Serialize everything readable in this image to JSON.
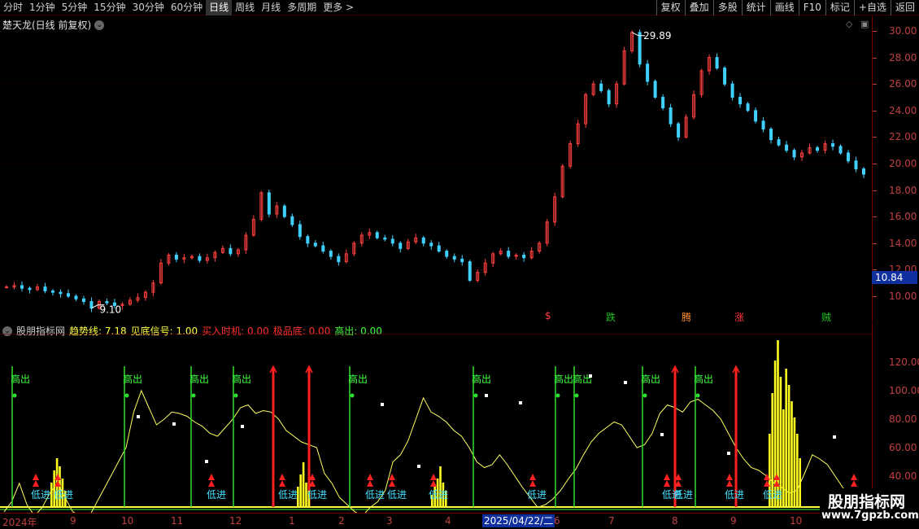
{
  "toolbar": {
    "periods": [
      "分时",
      "1分钟",
      "5分钟",
      "15分钟",
      "30分钟",
      "60分钟",
      "日线",
      "周线",
      "月线",
      "多周期",
      "更多 >"
    ],
    "active_period": "日线",
    "tools": [
      "复权",
      "叠加",
      "多股",
      "统计",
      "画线",
      "F10",
      "标记",
      "+自选",
      "返回"
    ]
  },
  "main": {
    "title": "楚天龙(日线 前复权)",
    "high_label": "29.89",
    "low_label": "9.10",
    "current_price": "10.84",
    "price_axis": [
      "30.00",
      "28.00",
      "26.00",
      "24.00",
      "22.00",
      "20.00",
      "18.00",
      "16.00",
      "14.00",
      "12.00",
      "10.00"
    ],
    "signals": [
      {
        "text": "$",
        "color": "#ff4040"
      },
      {
        "text": "跌",
        "color": "#20c020"
      },
      {
        "text": "腾",
        "color": "#ff9030"
      },
      {
        "text": "涨",
        "color": "#ff3030"
      },
      {
        "text": "贼",
        "color": "#20c020"
      }
    ]
  },
  "indicator": {
    "name": "股朋指标网",
    "fields": [
      {
        "label": "趋势线: 7.18",
        "color": "#ffff40"
      },
      {
        "label": "见底信号: 1.00",
        "color": "#ffff40"
      },
      {
        "label": "买入时机: 0.00",
        "color": "#ff3030"
      },
      {
        "label": "极品底: 0.00",
        "color": "#ff3030"
      },
      {
        "label": "高出: 0.00",
        "color": "#40ff40"
      }
    ],
    "axis": [
      "120.00",
      "100.00",
      "80.00",
      "60.00",
      "40.00",
      "20.00"
    ],
    "gao_chu": "高出",
    "di_jin": "低进"
  },
  "time_axis": {
    "labels": [
      "2024年",
      "9",
      "10",
      "11",
      "12",
      "1",
      "2",
      "3",
      "4",
      "6",
      "7",
      "8",
      "9",
      "10"
    ],
    "cursor": "2025/04/22/二"
  },
  "watermark": {
    "title": "股朋指标网",
    "url": "www.7gpzb.com"
  },
  "chart_data": {
    "type": "candlestick",
    "title": "楚天龙(日线 前复权)",
    "y_range": [
      9.0,
      30.4
    ],
    "high": 29.89,
    "low": 9.1,
    "last_price": 10.84,
    "price_path": [
      10.7,
      10.8,
      10.6,
      10.5,
      10.7,
      10.4,
      10.3,
      10.2,
      10.0,
      9.8,
      9.6,
      9.1,
      9.6,
      9.5,
      9.3,
      9.4,
      9.7,
      9.9,
      10.3,
      11.0,
      12.5,
      13.1,
      12.8,
      12.9,
      13.0,
      12.7,
      12.9,
      13.3,
      13.6,
      13.2,
      13.5,
      14.6,
      15.8,
      17.8,
      16.2,
      16.8,
      16.0,
      15.4,
      14.5,
      14.0,
      13.8,
      13.4,
      13.0,
      12.6,
      13.2,
      14.0,
      14.6,
      14.8,
      14.4,
      14.3,
      14.0,
      13.6,
      14.1,
      14.4,
      14.0,
      13.8,
      13.4,
      13.0,
      12.8,
      12.6,
      11.2,
      11.8,
      12.5,
      13.2,
      13.4,
      13.0,
      13.1,
      12.9,
      13.4,
      14.0,
      15.6,
      17.5,
      19.8,
      21.5,
      23.0,
      25.2,
      26.0,
      25.5,
      24.5,
      26.0,
      28.5,
      29.89,
      27.5,
      26.2,
      25.0,
      24.2,
      23.0,
      22.0,
      23.5,
      25.2,
      27.0,
      28.0,
      27.2,
      26.0,
      25.0,
      24.5,
      24.0,
      23.2,
      22.6,
      21.8,
      21.4,
      21.0,
      20.5,
      20.8,
      21.2,
      21.0,
      21.5,
      21.3,
      20.8,
      20.2,
      19.6,
      19.2
    ],
    "indicator_trend": [
      15,
      22,
      35,
      20,
      12,
      18,
      28,
      35,
      25,
      15,
      12,
      10,
      20,
      30,
      40,
      50,
      60,
      85,
      100,
      88,
      76,
      80,
      85,
      84,
      82,
      78,
      75,
      70,
      68,
      74,
      80,
      88,
      90,
      84,
      86,
      85,
      80,
      72,
      68,
      64,
      62,
      60,
      42,
      35,
      25,
      20,
      15,
      12,
      18,
      22,
      30,
      50,
      55,
      65,
      80,
      95,
      85,
      82,
      78,
      72,
      68,
      60,
      50,
      46,
      48,
      55,
      48,
      40,
      32,
      25,
      18,
      20,
      24,
      30,
      38,
      45,
      55,
      64,
      70,
      74,
      78,
      76,
      68,
      60,
      62,
      70,
      84,
      90,
      88,
      85,
      92,
      94,
      90,
      86,
      80,
      70,
      60,
      52,
      46,
      44,
      40,
      35,
      32,
      28,
      30,
      42,
      55,
      52,
      48,
      40,
      32,
      24,
      18
    ]
  }
}
